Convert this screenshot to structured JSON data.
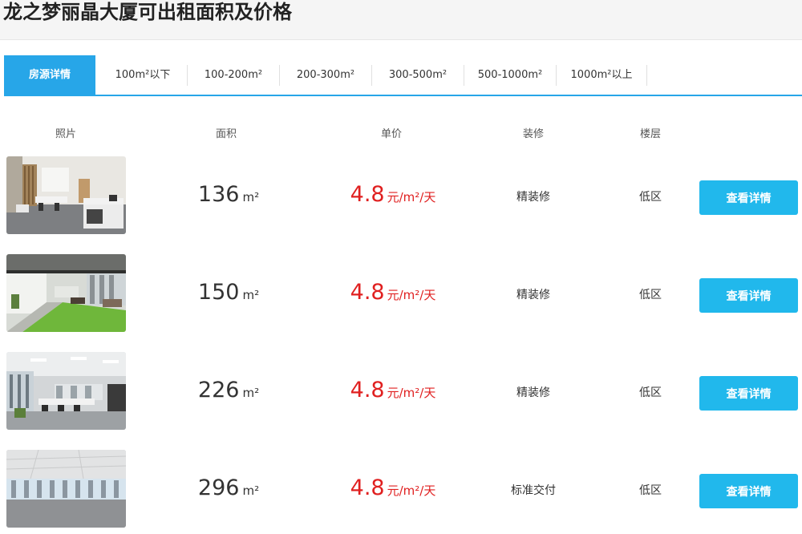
{
  "page": {
    "title": "龙之梦丽晶大厦可出租面积及价格"
  },
  "tabs": [
    {
      "label": "房源详情",
      "active": true
    },
    {
      "label": "100m²以下"
    },
    {
      "label": "100-200m²"
    },
    {
      "label": "200-300m²"
    },
    {
      "label": "300-500m²"
    },
    {
      "label": "500-1000m²"
    },
    {
      "label": "1000m²以上"
    }
  ],
  "columns": {
    "photo": "照片",
    "area": "面积",
    "price": "单价",
    "decoration": "装修",
    "floor": "楼层"
  },
  "listings": [
    {
      "area": "136",
      "area_unit": "m²",
      "price": "4.8",
      "price_unit": "元/m²/天",
      "decoration": "精装修",
      "floor": "低区",
      "button": "查看详情"
    },
    {
      "area": "150",
      "area_unit": "m²",
      "price": "4.8",
      "price_unit": "元/m²/天",
      "decoration": "精装修",
      "floor": "低区",
      "button": "查看详情"
    },
    {
      "area": "226",
      "area_unit": "m²",
      "price": "4.8",
      "price_unit": "元/m²/天",
      "decoration": "精装修",
      "floor": "低区",
      "button": "查看详情"
    },
    {
      "area": "296",
      "area_unit": "m²",
      "price": "4.8",
      "price_unit": "元/m²/天",
      "decoration": "标准交付",
      "floor": "低区",
      "button": "查看详情"
    }
  ],
  "colors": {
    "accent": "#27a6e8",
    "button": "#21b8ec",
    "price": "#e02020"
  }
}
